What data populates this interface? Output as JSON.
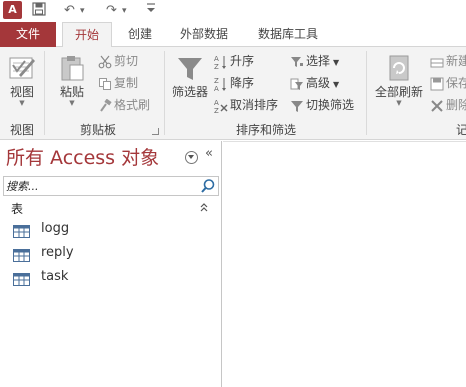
{
  "app": {
    "icon_letter": "A"
  },
  "quick_access": {
    "undo_glyph": "↶",
    "undo_dd": "▾",
    "redo_glyph": "↷",
    "redo_dd": "▾",
    "customize_glyph": "▾"
  },
  "tabs": {
    "file": "文件",
    "home": "开始",
    "create": "创建",
    "external": "外部数据",
    "dbtools": "数据库工具"
  },
  "ribbon": {
    "views": {
      "view_label": "视图",
      "group": "视图"
    },
    "clipboard": {
      "paste_label": "粘贴",
      "cut": "剪切",
      "copy": "复制",
      "format_painter": "格式刷",
      "group": "剪贴板"
    },
    "sort_filter": {
      "filter_label": "筛选器",
      "ascending": "升序",
      "descending": "降序",
      "clear_sort": "取消排序",
      "selection": "选择",
      "advanced": "高级",
      "toggle_filter": "切换筛选",
      "group": "排序和筛选"
    },
    "records": {
      "refresh_all": "全部刷新",
      "new": "新建",
      "save": "保存",
      "delete": "删除",
      "group": "记"
    }
  },
  "nav": {
    "title": "所有 Access 对象",
    "search_placeholder": "搜索...",
    "group_header": "表",
    "items": [
      {
        "label": "logg"
      },
      {
        "label": "reply"
      },
      {
        "label": "task"
      }
    ]
  }
}
